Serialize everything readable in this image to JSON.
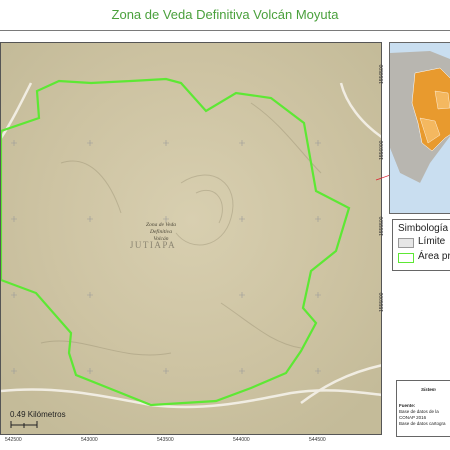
{
  "title": "Zona de Veda Definitiva Volcán Moyuta",
  "colors": {
    "title": "#4aa03c",
    "boundary": "#5de834",
    "terrain": "#cfc6a6",
    "limit_swatch": "#e6e6e6"
  },
  "grid": {
    "top_ticks": [
      "542500",
      "543000",
      "543500",
      "544000",
      "544500"
    ],
    "bottom_ticks": [
      "542500",
      "543000",
      "543500",
      "544000",
      "544500"
    ],
    "right_ticks": [
      "1556500",
      "1556000",
      "1555500",
      "1555000"
    ]
  },
  "map_labels": {
    "zone_label_1": "Zona de Veda",
    "zone_label_2": "Definitiva",
    "zone_label_3": "Volcán",
    "place": "JUTIAPA"
  },
  "scale": {
    "label": "0.49 Kilómetros"
  },
  "legend": {
    "title": "Simbología",
    "items": [
      {
        "label": "Límite",
        "color": "#e6e6e6"
      },
      {
        "label": "Área pr",
        "color": "#5de834"
      }
    ]
  },
  "source": {
    "header": "Sistem",
    "fuente": "Fuente:",
    "line1": "Base de datos de la",
    "line2": "CONAP 2016",
    "line3": "Base de datos cartogra"
  }
}
